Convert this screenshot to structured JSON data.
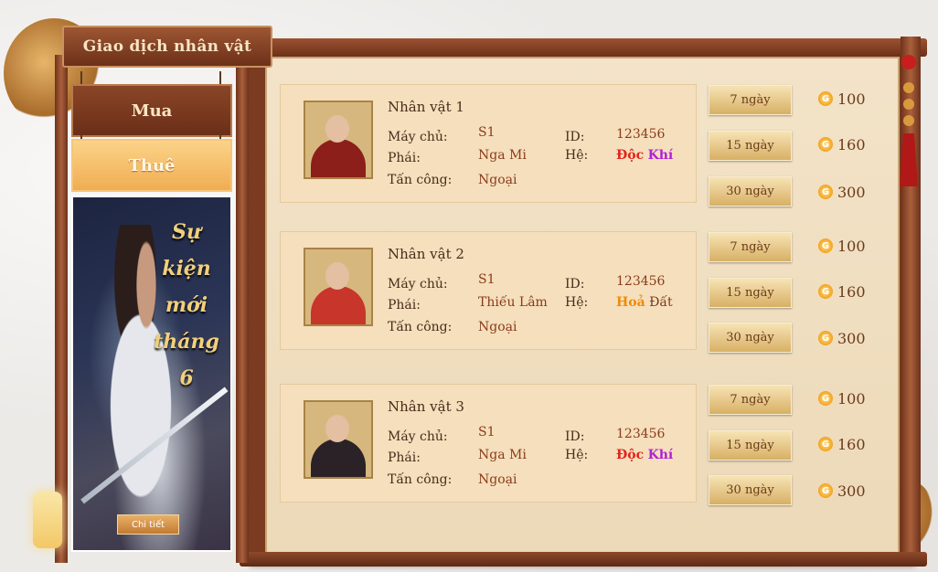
{
  "header": {
    "title": "Giao dịch nhân vật"
  },
  "tabs": {
    "buy": "Mua",
    "rent": "Thuê"
  },
  "banner": {
    "line1": "Sự",
    "line2": "kiện",
    "line3": "mới",
    "line4": "tháng",
    "line5": "6",
    "detail_label": "Chi tiết"
  },
  "labels": {
    "server": "Máy chủ:",
    "faction": "Phái:",
    "attack": "Tấn công:",
    "id": "ID:",
    "element": "Hệ:"
  },
  "characters": [
    {
      "name": "Nhân vật 1",
      "server": "S1",
      "faction": "Nga Mi",
      "attack": "Ngoại",
      "id": "123456",
      "element_1": "Độc",
      "element_2": "Khí"
    },
    {
      "name": "Nhân vật 2",
      "server": "S1",
      "faction": "Thiếu Lâm",
      "attack": "Ngoại",
      "id": "123456",
      "element_1": "Hoả",
      "element_2": "Đất"
    },
    {
      "name": "Nhân vật 3",
      "server": "S1",
      "faction": "Nga Mi",
      "attack": "Ngoại",
      "id": "123456",
      "element_1": "Độc",
      "element_2": "Khí"
    }
  ],
  "rent_options": [
    {
      "duration": "7 ngày",
      "price": "100"
    },
    {
      "duration": "15 ngày",
      "price": "160"
    },
    {
      "duration": "30 ngày",
      "price": "300"
    }
  ],
  "coin_symbol": "G",
  "colors": {
    "frame": "#7a3b21",
    "panel": "#f5dfbc",
    "rent_tab": "#f0ad52",
    "gold_button": "#d7b065",
    "element_red": "#e0251b",
    "element_purple": "#b021d6",
    "element_orange": "#f28a00"
  }
}
